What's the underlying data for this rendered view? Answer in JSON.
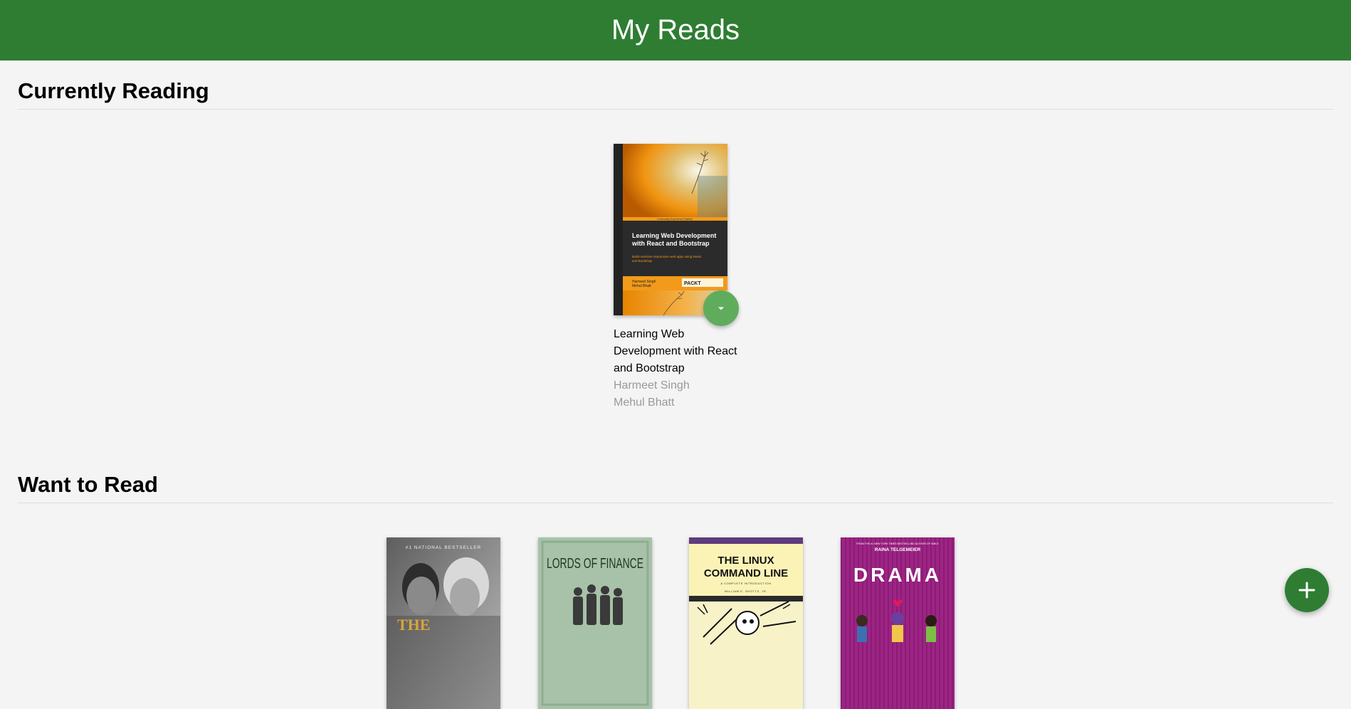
{
  "app": {
    "title": "My Reads"
  },
  "shelves": [
    {
      "title": "Currently Reading",
      "books": [
        {
          "title": "Learning Web Development with React and Bootstrap",
          "authors": [
            "Harmeet Singh",
            "Mehul Bhatt"
          ],
          "cover_text": {
            "tagline": "Community Experience Distilled",
            "title_line1": "Learning Web Development",
            "title_line2": "with React and Bootstrap",
            "subtitle_line1": "Build real-time responsive web apps using React",
            "subtitle_line2": "and Bootstrap",
            "author1": "Harmeet Singh",
            "author2": "Mehul Bhatt",
            "publisher": "PACKT"
          }
        }
      ]
    },
    {
      "title": "Want to Read",
      "books": [
        {
          "cover_text": {
            "top": "#1 NATIONAL BESTSELLER",
            "title": "THE"
          }
        },
        {
          "cover_text": {
            "title": "LORDS OF FINANCE"
          }
        },
        {
          "cover_text": {
            "title_line1": "THE LINUX",
            "title_line2": "COMMAND LINE",
            "subtitle": "A COMPLETE INTRODUCTION",
            "author": "WILLIAM E. SHOTTS, JR."
          }
        },
        {
          "cover_text": {
            "top": "FROM THE #1 NEW YORK TIMES BESTSELLING AUTHOR OF SMILE",
            "author": "RAINA TELGEMEIER",
            "title": "DRAMA"
          }
        }
      ]
    }
  ],
  "icons": {
    "shelf_changer": "arrow-drop-down-icon",
    "add": "plus-icon"
  },
  "colors": {
    "header": "#2e7d32",
    "changer": "#60ac5d",
    "author_text": "#999999",
    "background": "#f4f4f4"
  }
}
